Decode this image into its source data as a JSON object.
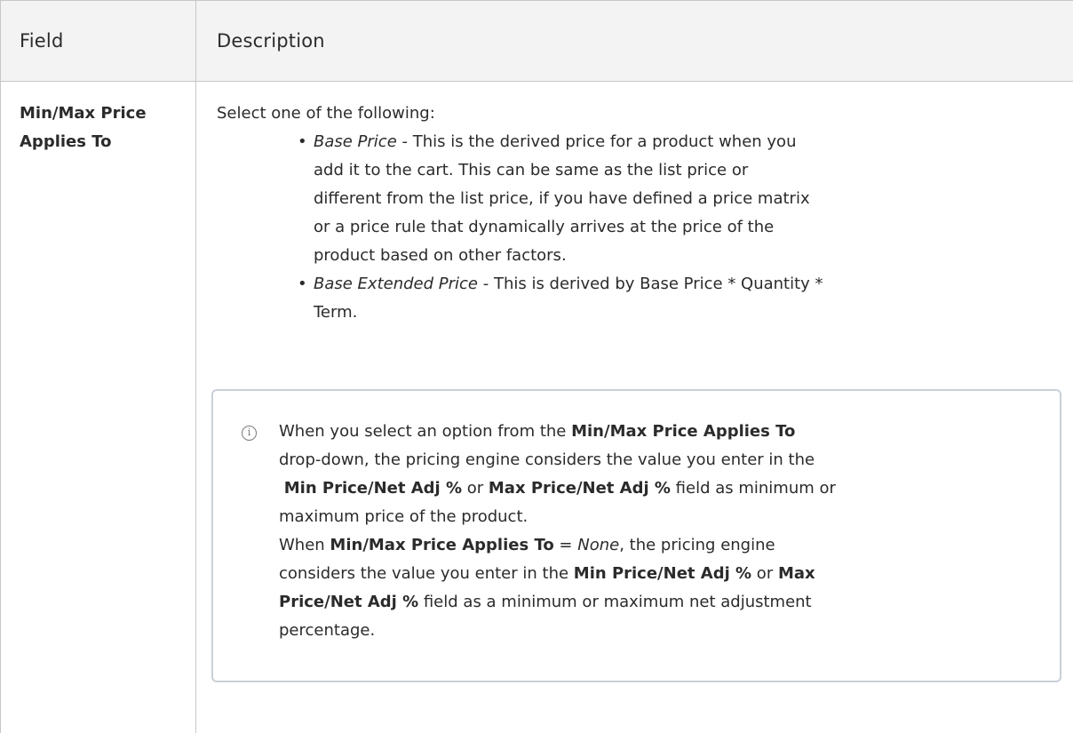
{
  "table": {
    "headers": {
      "field": "Field",
      "description": "Description"
    },
    "row": {
      "field_line1": "Min/Max Price",
      "field_line2": "Applies To",
      "intro": "Select one of the following:",
      "options": [
        {
          "name": "Base Price",
          "dash": " - ",
          "text_l1": "This is the derived price for a product when you",
          "text_l2": "add it to the cart. This can be same as the list price or",
          "text_l3": "different from the list price, if you have defined a price matrix",
          "text_l4": "or a price rule that dynamically arrives at the price of the",
          "text_l5": "product based on other factors."
        },
        {
          "name": "Base Extended Price",
          "dash": " - ",
          "text_l1": "This is derived by Base Price * Quantity *",
          "text_l2": "Term."
        }
      ],
      "note": {
        "icon": "info-icon",
        "p1_a": "When you select an option from the ",
        "p1_b": "Min/Max Price Applies To",
        "p1_c": "drop-down, the pricing engine considers the value you enter in the",
        "p1_d": "Min Price/Net Adj %",
        "p1_e": " or ",
        "p1_f": "Max Price/Net Adj %",
        "p1_g": " field as minimum or",
        "p1_h": "maximum price of the product.",
        "p2_a": "When ",
        "p2_b": "Min/Max Price Applies To",
        "p2_c": " = ",
        "p2_d": "None",
        "p2_e": ", the pricing engine",
        "p2_f": "considers the value you enter in the ",
        "p2_g": "Min Price/Net Adj %",
        "p2_h": " or ",
        "p2_i": "Max",
        "p2_j": "Price/Net Adj %",
        "p2_k": " field as a minimum or maximum net adjustment",
        "p2_l": "percentage."
      }
    }
  }
}
